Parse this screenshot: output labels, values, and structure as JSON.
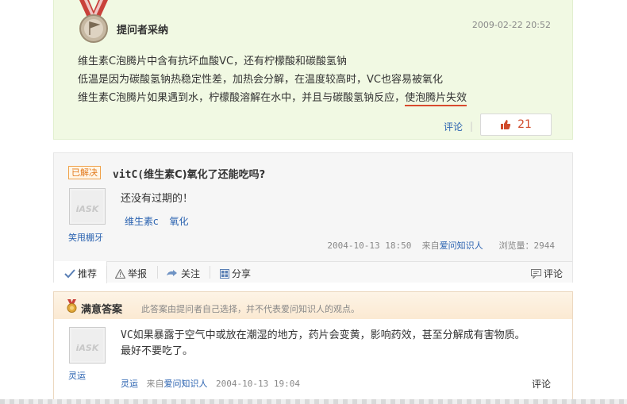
{
  "adopted": {
    "title": "提问者采纳",
    "time": "2009-02-22 20:52",
    "line1": "维生素C泡腾片中含有抗坏血酸VC，还有柠檬酸和碳酸氢钠",
    "line2": "低温是因为碳酸氢钠热稳定性差，加热会分解，在温度较高时，VC也容易被氧化",
    "line3a": "维生素C泡腾片如果遇到水，柠檬酸溶解在水中，并且与碳酸氢钠反应，",
    "line3b": "使泡腾片失效",
    "comment": "评论",
    "like_count": "21"
  },
  "question": {
    "solved": "已解决",
    "title_prefix": "vitC(",
    "title_bold": "维生素C)氧化了还能吃吗?",
    "asker": "笑甩棚牙",
    "body": "还没有过期的！",
    "tags": [
      "维生素c",
      "氧化"
    ],
    "time": "2004-10-13 18:50",
    "from_label": "来自",
    "source": "爱问知识人",
    "views": "浏览量：2944",
    "toolbar": {
      "recommend": "推荐",
      "report": "举报",
      "follow": "关注",
      "share": "分享",
      "comment": "评论"
    }
  },
  "satisfied": {
    "title": "满意答案",
    "note": "此答案由提问者自己选择，并不代表爱问知识人的观点。",
    "answerer": "灵运",
    "line1": "VC如果暴露于空气中或放在潮湿的地方，药片会变黄，影响药效，甚至分解成有害物质。",
    "line2": "最好不要吃了。",
    "meta_name": "灵运",
    "from_label": "来自",
    "source": "爱问知识人",
    "time": "2004-10-13 19:04",
    "comment": "评论"
  },
  "colors": {
    "accent_red": "#d04a2a",
    "link_blue": "#2a62b0",
    "adopt_bg": "#f1f9e3"
  }
}
